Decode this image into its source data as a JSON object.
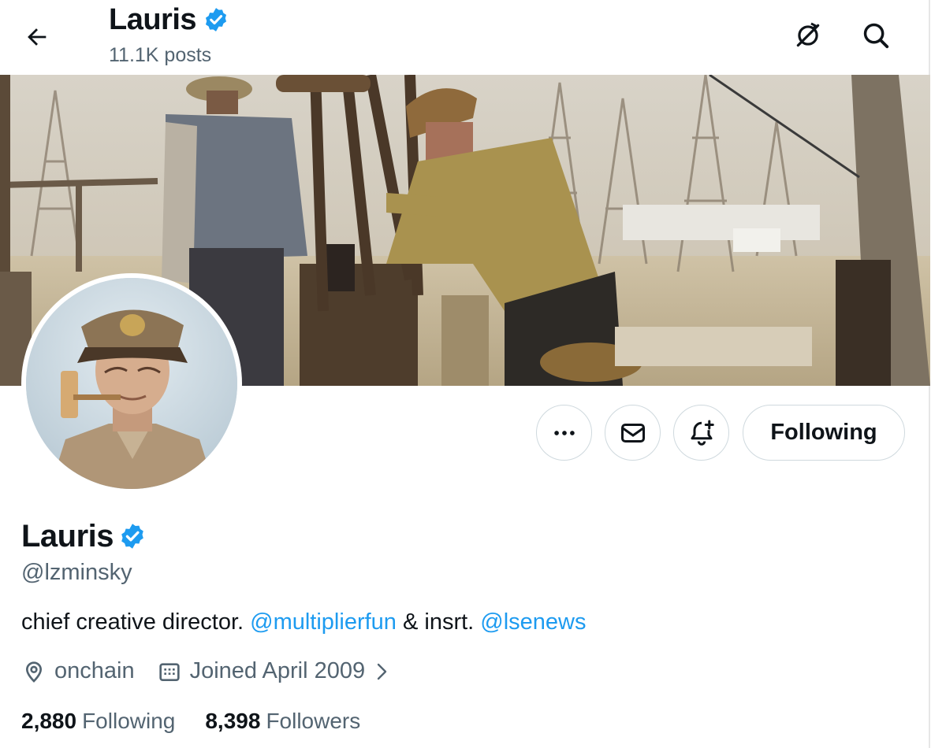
{
  "header": {
    "name": "Lauris",
    "posts_count": "11.1K posts"
  },
  "profile": {
    "name": "Lauris",
    "handle": "@lzminsky",
    "bio": {
      "text_1": "chief creative director. ",
      "mention_1": "@multiplierfun",
      "text_2": " & insrt. ",
      "mention_2": "@lsenews"
    },
    "location": "onchain",
    "joined": "Joined April 2009",
    "following_count": "2,880",
    "following_label": "Following",
    "followers_count": "8,398",
    "followers_label": "Followers"
  },
  "actions": {
    "following_button": "Following"
  },
  "icons": {
    "back": "arrow-left-icon",
    "sync": "sync-slash-icon",
    "search": "search-icon",
    "more": "more-dots-icon",
    "message": "envelope-icon",
    "notify": "bell-plus-icon",
    "verified": "verified-badge-icon",
    "location": "location-pin-icon",
    "calendar": "calendar-icon",
    "chevron": "chevron-right-icon"
  },
  "colors": {
    "accent": "#1d9bf0",
    "text_primary": "#0f1419",
    "text_secondary": "#536471",
    "border": "#cfd9de"
  }
}
